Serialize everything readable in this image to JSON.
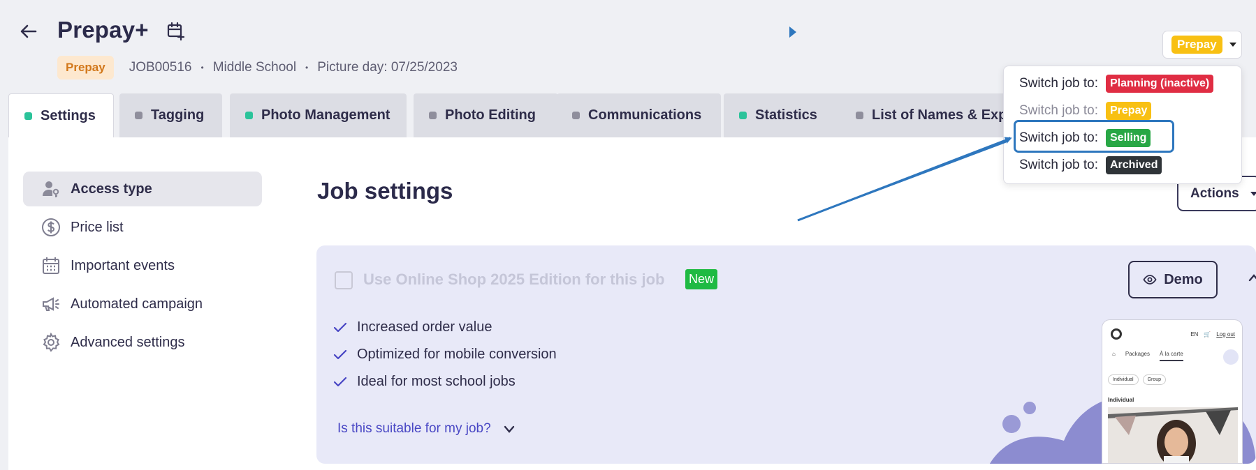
{
  "header": {
    "title": "Prepay+",
    "status_badge": "Prepay",
    "job_id": "JOB00516",
    "school": "Middle School",
    "picture_day": "Picture day: 07/25/2023",
    "bullet": "•"
  },
  "status_dropdown": {
    "current": "Prepay",
    "items": [
      {
        "label": "Switch job to:",
        "status": "Planning (inactive)",
        "color": "#e02d43",
        "enabled": true
      },
      {
        "label": "Switch job to:",
        "status": "Prepay",
        "color": "#f8c013",
        "enabled": false
      },
      {
        "label": "Switch job to:",
        "status": "Selling",
        "color": "#28a745",
        "enabled": true
      },
      {
        "label": "Switch job to:",
        "status": "Archived",
        "color": "#2f3438",
        "enabled": true
      }
    ]
  },
  "tabs": [
    {
      "label": "Settings",
      "dot": "green",
      "active": true
    },
    {
      "label": "Tagging",
      "dot": "gray"
    },
    {
      "label": "Photo Management",
      "dot": "green"
    },
    {
      "label": "Photo Editing",
      "dot": "gray"
    },
    {
      "label": "Communications",
      "dot": "gray"
    },
    {
      "label": "Statistics",
      "dot": "green"
    },
    {
      "label": "List of Names & Exp",
      "dot": "gray"
    }
  ],
  "sidebar": {
    "items": [
      {
        "label": "Access type",
        "icon": "user-key-icon",
        "active": true
      },
      {
        "label": "Price list",
        "icon": "dollar-circle-icon"
      },
      {
        "label": "Important events",
        "icon": "calendar-icon"
      },
      {
        "label": "Automated campaign",
        "icon": "megaphone-icon"
      },
      {
        "label": "Advanced settings",
        "icon": "gear-icon"
      }
    ]
  },
  "main": {
    "title": "Job settings",
    "actions_label": "Actions"
  },
  "shop_card": {
    "title": "Use Online Shop 2025 Edition for this job",
    "new_badge": "New",
    "demo_label": "Demo",
    "features": [
      "Increased order value",
      "Optimized for mobile conversion",
      "Ideal for most school jobs"
    ],
    "suitable_link": "Is this suitable for my job?"
  },
  "phone_preview": {
    "lang": "EN",
    "logout": "Log out",
    "tabs": [
      "Packages",
      "À la carte"
    ],
    "pills": [
      "Individual",
      "Group"
    ],
    "section": "Individual"
  },
  "colors": {
    "accent_blue": "#2e77be",
    "brand_navy": "#2f2d4a",
    "link": "#4846c4"
  }
}
